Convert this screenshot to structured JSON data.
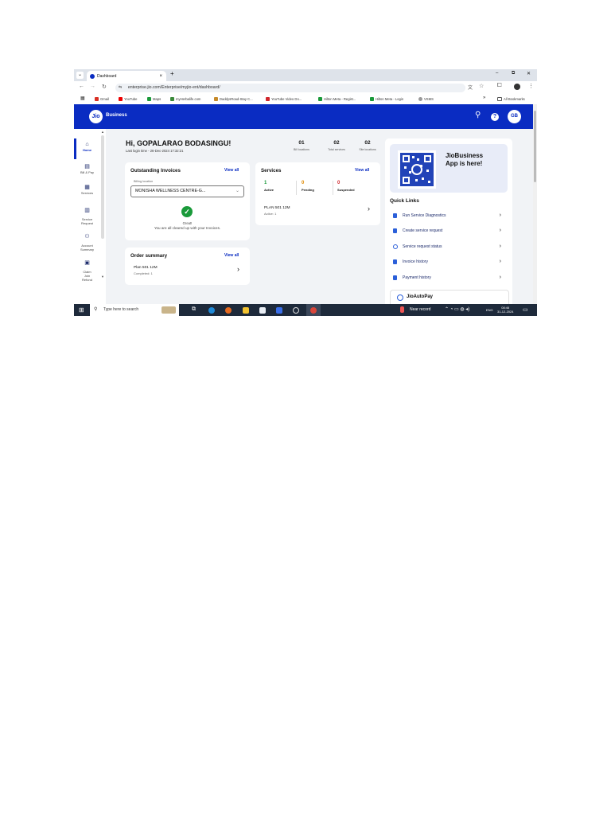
{
  "browser": {
    "tab_title": "Dashboard",
    "new_tab": "+",
    "tab_menu": "⌄",
    "close_tab": "×",
    "url": "enterprise.jio.com/Enterprise/myjio-ent/dashboard/",
    "window_controls": [
      "–",
      "⧉",
      "✕"
    ],
    "bookmarks": [
      "Gmail",
      "YouTube",
      "Maps",
      "myHerbalife.com",
      "DaddysRoad-Stay C...",
      "YouTube Video Do...",
      "Hilton Meta - Regist...",
      "Hilton Meta - Login",
      "VSMS"
    ],
    "bookmarks_overflow": "»",
    "all_bookmarks": "All Bookmarks"
  },
  "header": {
    "logo": "Jio",
    "brand": "Business",
    "avatar_initials": "GB"
  },
  "sidebar": {
    "items": [
      {
        "label": "Home",
        "icon": "home-icon",
        "glyph": "⌂"
      },
      {
        "label": "Bill & Pay",
        "icon": "bill-icon",
        "glyph": "▤"
      },
      {
        "label": "Services",
        "icon": "grid-icon",
        "glyph": "▦"
      },
      {
        "label": "Service\nRequest",
        "icon": "document-icon",
        "glyph": "▥"
      },
      {
        "label": "Account\nSummary",
        "icon": "people-icon",
        "glyph": "⚇"
      },
      {
        "label": "Claim\nJoin\nRefund",
        "icon": "refund-icon",
        "glyph": "▣"
      }
    ]
  },
  "greeting": {
    "title": "Hi, GOPALARAO BODASINGU!",
    "last_login": "Last login time - 26-Dec-2024 17:32:21"
  },
  "stats": [
    {
      "value": "01",
      "label": "Bill locations"
    },
    {
      "value": "02",
      "label": "Total services"
    },
    {
      "value": "02",
      "label": "Site locations"
    }
  ],
  "invoices": {
    "title": "Outstanding Invoices",
    "view_all": "View all",
    "billing_label": "Billing location",
    "billing_value": "MONISHA WELLNESS CENTRE-G...",
    "status_title": "Great!",
    "status_text": "You are all cleared up with your Invoices."
  },
  "services": {
    "title": "Services",
    "view_all": "View all",
    "counts": [
      {
        "value": "1",
        "label": "Active",
        "color": "#1a9a3a"
      },
      {
        "value": "0",
        "label": "Pending",
        "color": "#e08a00"
      },
      {
        "value": "0",
        "label": "Suspended",
        "color": "#d0262c"
      }
    ],
    "plan": {
      "name": "PLAN 501 12M",
      "status": "Active: 1"
    }
  },
  "orders": {
    "title": "Order summary",
    "view_all": "View all",
    "plan": {
      "name": "Plan 501 12M",
      "status": "Completed: 1"
    }
  },
  "app_promo": {
    "title": "JioBusiness\nApp is here!"
  },
  "quick_links": {
    "title": "Quick Links",
    "items": [
      "Run Service Diagnostics",
      "Create service request",
      "Service request status",
      "Invoice history",
      "Payment history"
    ]
  },
  "autopay": {
    "title": "JioAutoPay"
  },
  "taskbar": {
    "search_placeholder": "Type here to search",
    "record": "Near record",
    "lang": "ENG",
    "time": "08:46",
    "date": "31-12-2024"
  },
  "colors": {
    "jio_blue": "#0a2cc2",
    "taskbar": "#1e2a3b"
  }
}
